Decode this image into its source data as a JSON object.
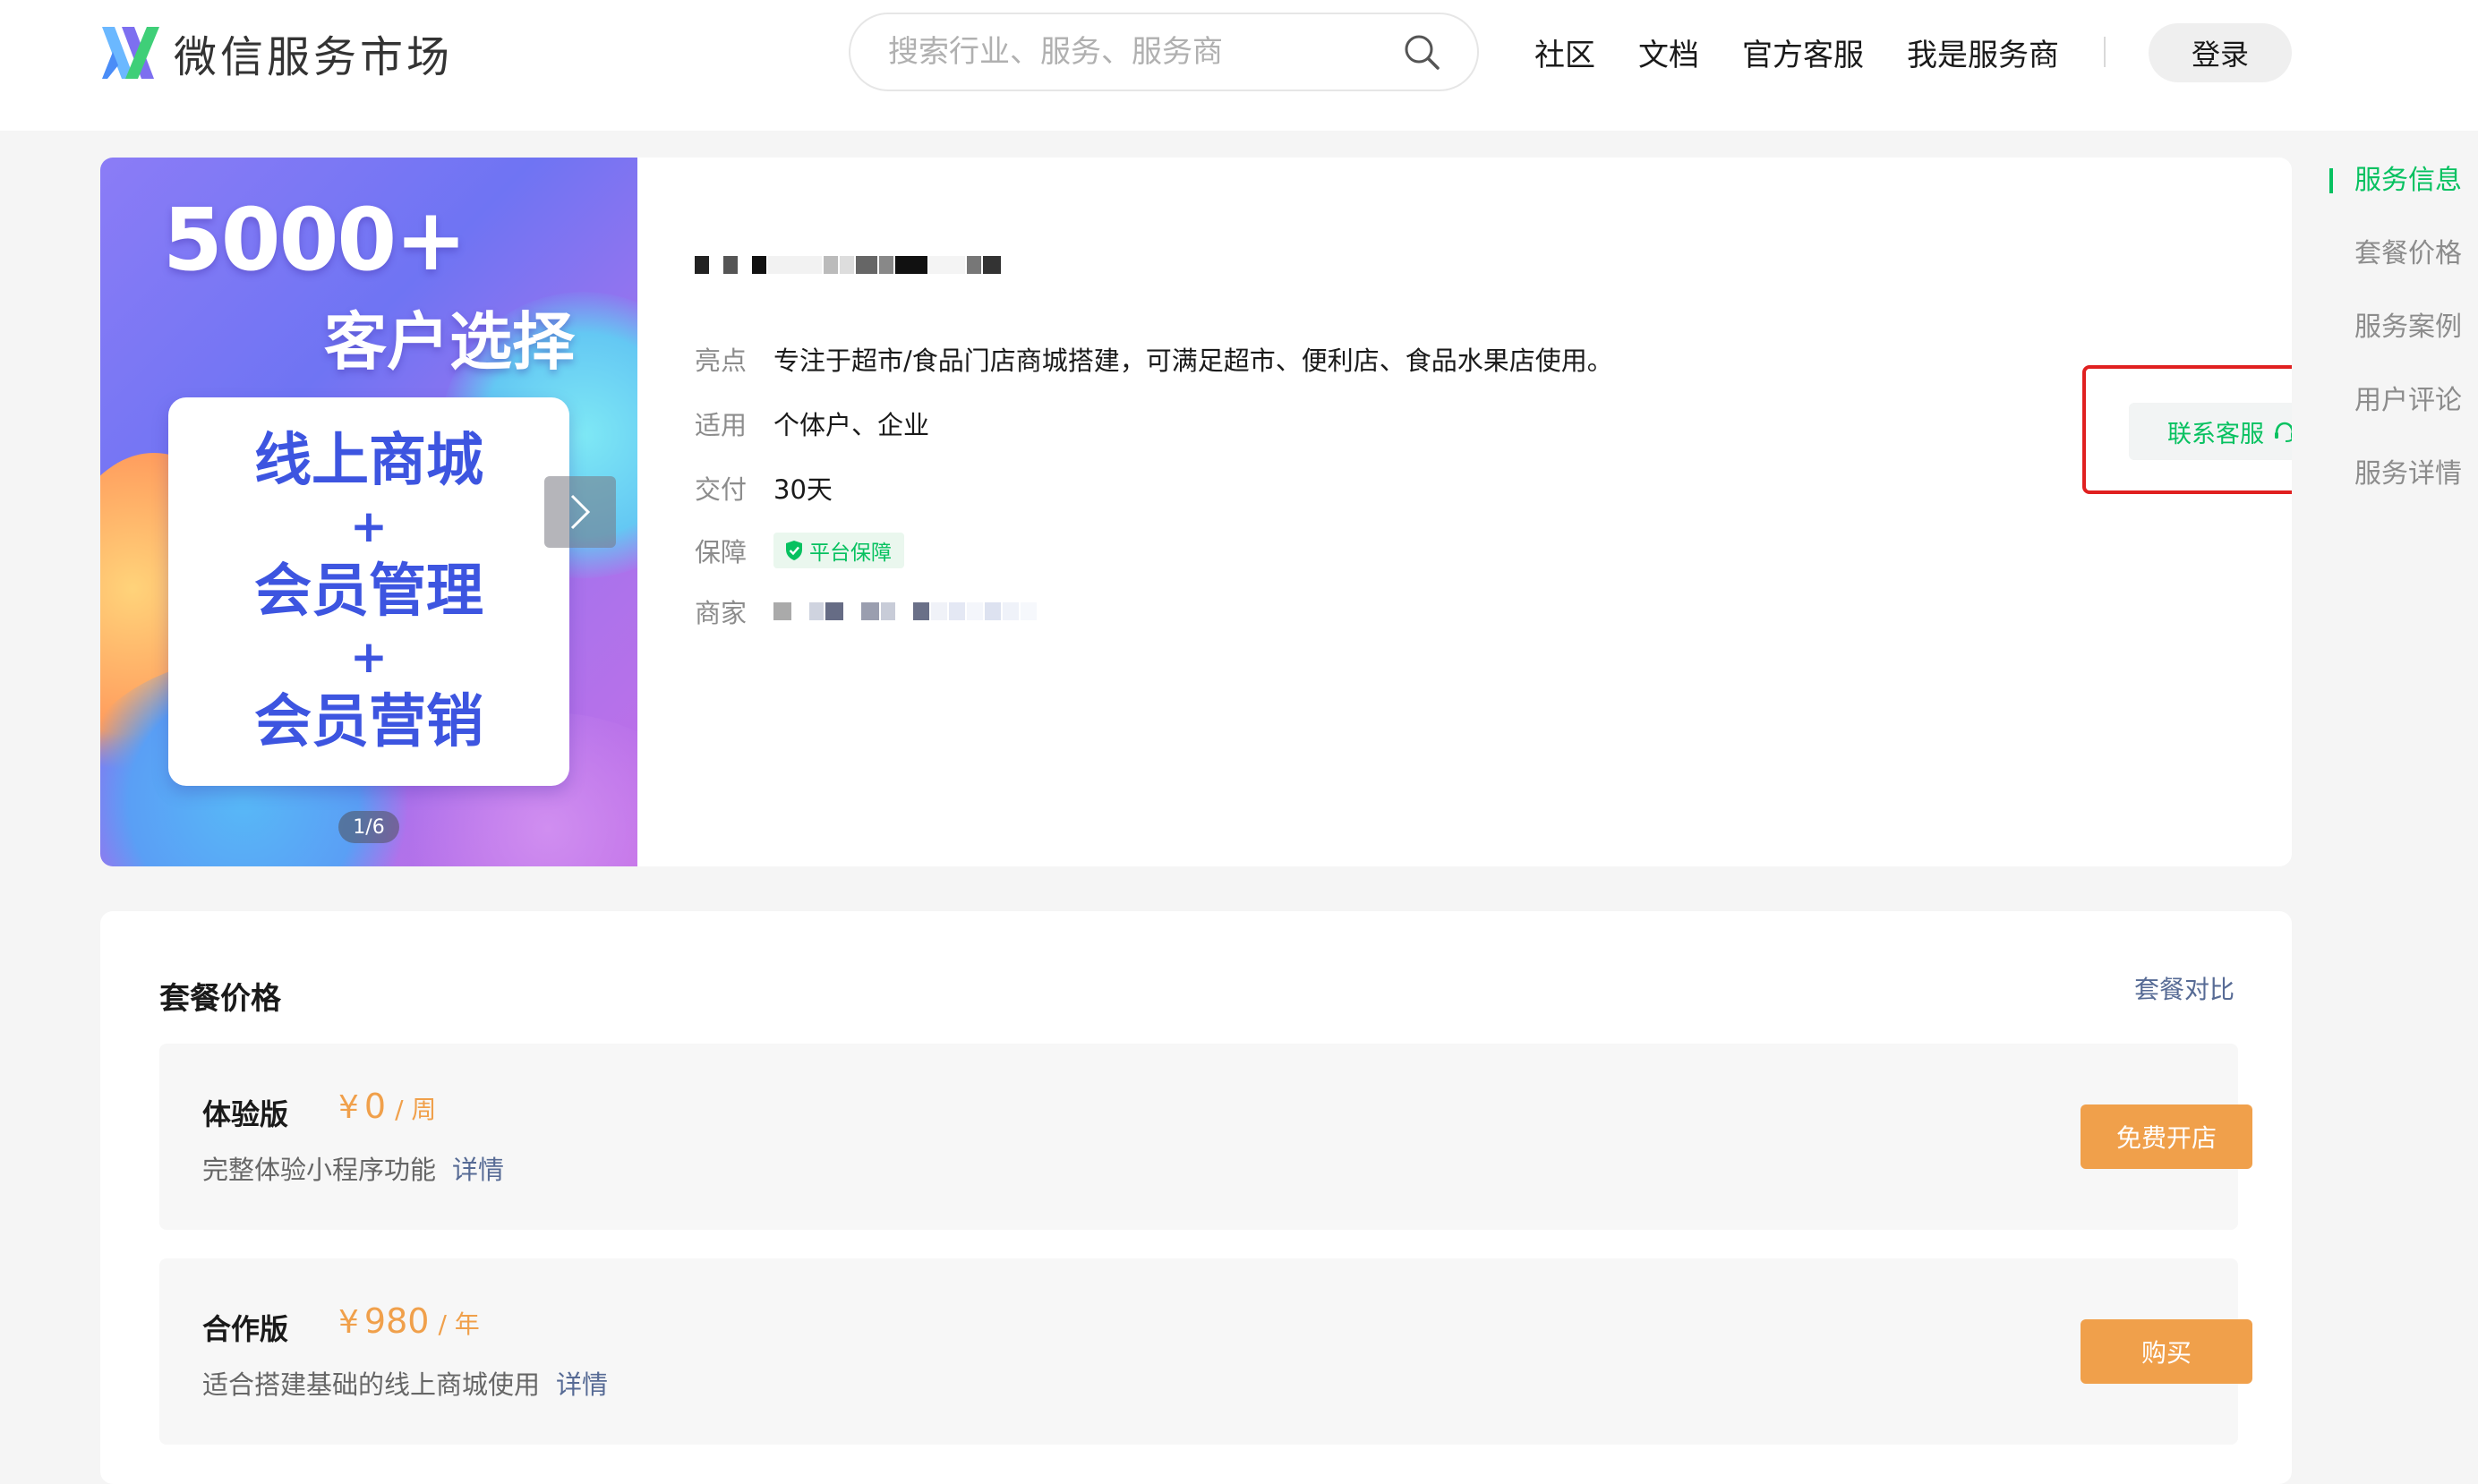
{
  "header": {
    "brand": "微信服务市场",
    "search_placeholder": "搜索行业、服务、服务商",
    "nav": [
      "社区",
      "文档",
      "官方客服",
      "我是服务商"
    ],
    "login": "登录"
  },
  "service": {
    "banner": {
      "headline": "5000+",
      "subline": "客户选择",
      "lines": [
        "线上商城",
        "+",
        "会员管理",
        "+",
        "会员营销"
      ],
      "counter": "1/6"
    },
    "fields": [
      {
        "label": "亮点",
        "value": "专注于超市/食品门店商城搭建，可满足超市、便利店、食品水果店使用。"
      },
      {
        "label": "适用",
        "value": "个体户、企业"
      },
      {
        "label": "交付",
        "value": "30天"
      },
      {
        "label": "保障",
        "value": "平台保障"
      },
      {
        "label": "商家",
        "value": ""
      }
    ],
    "contact": "联系客服"
  },
  "anchors": [
    "服务信息",
    "套餐价格",
    "服务案例",
    "用户评论",
    "服务详情"
  ],
  "packages": {
    "title": "套餐价格",
    "compare": "套餐对比",
    "items": [
      {
        "name": "体验版",
        "currency": "¥",
        "price": "0",
        "unit": "/ 周",
        "desc": "完整体验小程序功能",
        "detail": "详情",
        "button": "免费开店"
      },
      {
        "name": "合作版",
        "currency": "¥",
        "price": "980",
        "unit": "/ 年",
        "desc": "适合搭建基础的线上商城使用",
        "detail": "详情",
        "button": "购买"
      }
    ]
  },
  "colors": {
    "accent_green": "#07c160",
    "price_orange": "#f0a04b",
    "link_blue": "#576b95",
    "highlight_red": "#e02020"
  },
  "icons": [
    "logo-icon",
    "search-icon",
    "chevron-right-icon",
    "shield-check-icon",
    "headset-icon"
  ]
}
